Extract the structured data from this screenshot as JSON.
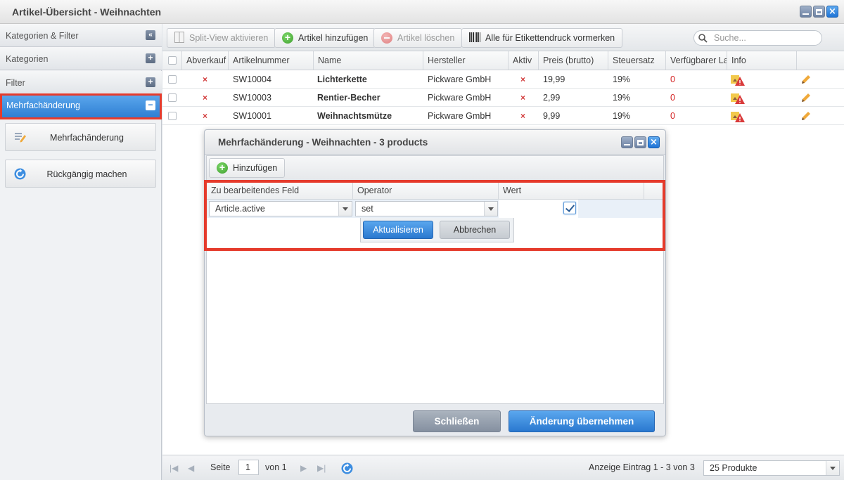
{
  "window": {
    "title": "Artikel-Übersicht - Weihnachten"
  },
  "sidebar": {
    "header": "Kategorien & Filter",
    "sections": [
      {
        "label": "Kategorien",
        "toggle": "+"
      },
      {
        "label": "Filter",
        "toggle": "+"
      },
      {
        "label": "Mehrfachänderung",
        "toggle": "−"
      }
    ],
    "buttons": [
      {
        "label": "Mehrfachänderung",
        "icon": "edit-list-icon"
      },
      {
        "label": "Rückgängig machen",
        "icon": "undo-icon"
      }
    ]
  },
  "toolbar": {
    "split_view": "Split-View aktivieren",
    "add": "Artikel hinzufügen",
    "delete": "Artikel löschen",
    "labels": "Alle für Etikettendruck vormerken",
    "search_placeholder": "Suche..."
  },
  "grid": {
    "columns": [
      "Abverkauf",
      "Artikelnummer",
      "Name",
      "Hersteller",
      "Aktiv",
      "Preis (brutto)",
      "Steuersatz",
      "Verfügbarer La",
      "Info"
    ],
    "rows": [
      {
        "number": "SW10004",
        "name": "Lichterkette",
        "manufacturer": "Pickware GmbH",
        "price": "19,99",
        "tax": "19%",
        "stock": "0"
      },
      {
        "number": "SW10003",
        "name": "Rentier-Becher",
        "manufacturer": "Pickware GmbH",
        "price": "2,99",
        "tax": "19%",
        "stock": "0"
      },
      {
        "number": "SW10001",
        "name": "Weihnachtsmütze",
        "manufacturer": "Pickware GmbH",
        "price": "9,99",
        "tax": "19%",
        "stock": "0"
      }
    ],
    "x_symbol": "×"
  },
  "dialog": {
    "title": "Mehrfachänderung - Weihnachten - 3 products",
    "add": "Hinzufügen",
    "columns": [
      "Zu bearbeitendes Feld",
      "Operator",
      "Wert"
    ],
    "field_value": "Article.active",
    "operator_value": "set",
    "update": "Aktualisieren",
    "cancel": "Abbrechen",
    "close": "Schließen",
    "apply": "Änderung übernehmen"
  },
  "footer": {
    "page_label": "Seite",
    "page_value": "1",
    "of_label": "von 1",
    "display": "Anzeige Eintrag 1 - 3 von 3",
    "page_size": "25 Produkte"
  },
  "colors": {
    "accent": "#2f7fd3",
    "highlight": "#e53b2c",
    "danger": "#d93a3a",
    "success": "#3e9e2c"
  }
}
